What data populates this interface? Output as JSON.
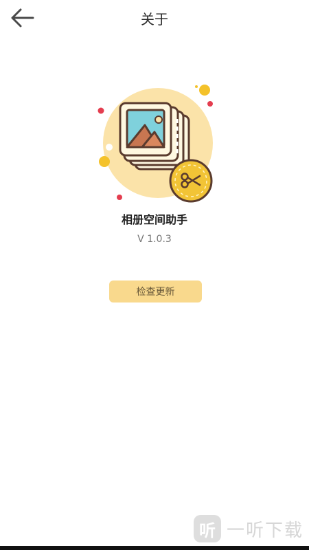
{
  "header": {
    "title": "关于",
    "back_icon": "arrow-left-icon"
  },
  "app": {
    "name": "相册空间助手",
    "version": "V 1.0.3",
    "icon": "photo-album-scissors-icon"
  },
  "actions": {
    "check_update": "检查更新"
  },
  "watermark": {
    "logo_char": "听",
    "text": "一听下载"
  },
  "colors": {
    "accent": "#f9d98d",
    "icon_circle": "#fbe3a9",
    "badge": "#f2c436",
    "outline": "#5a3b2e"
  }
}
